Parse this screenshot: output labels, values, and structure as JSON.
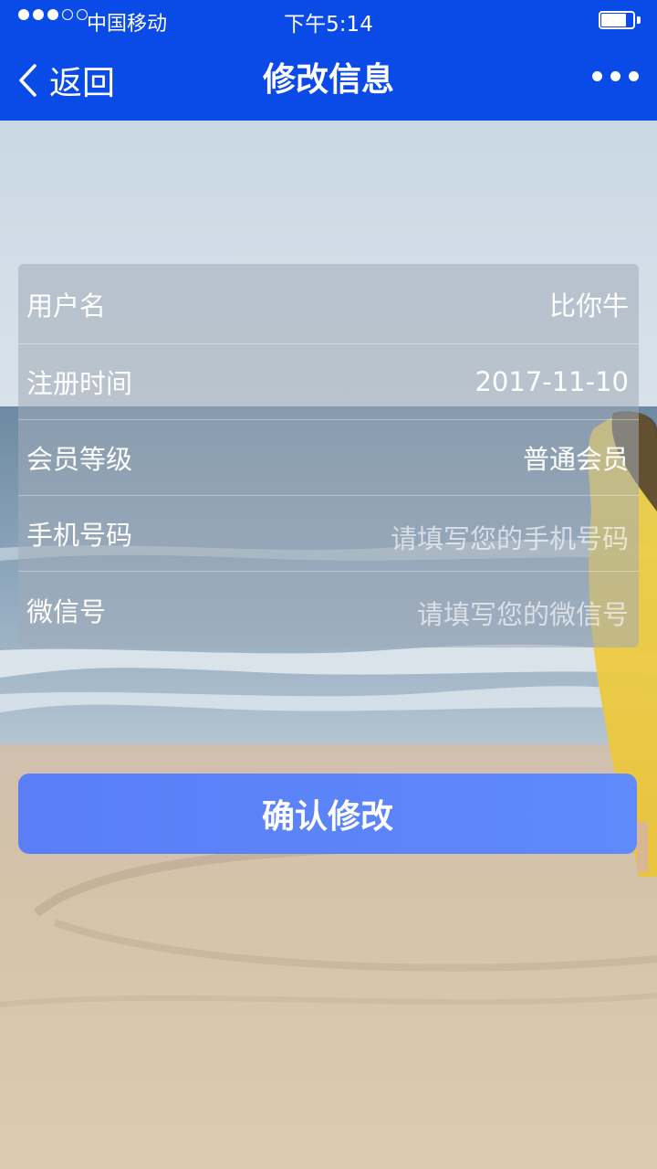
{
  "status_bar": {
    "signal_strength": 3,
    "signal_max": 5,
    "carrier": "中国移动",
    "time": "下午5:14",
    "battery_level": 0.8
  },
  "nav": {
    "back_label": "返回",
    "title": "修改信息"
  },
  "form": {
    "username": {
      "label": "用户名",
      "value": "比你牛"
    },
    "register_time": {
      "label": "注册时间",
      "value": "2017-11-10"
    },
    "member_level": {
      "label": "会员等级",
      "value": "普通会员"
    },
    "phone": {
      "label": "手机号码",
      "value": "",
      "placeholder": "请填写您的手机号码"
    },
    "wechat": {
      "label": "微信号",
      "value": "",
      "placeholder": "请填写您的微信号"
    }
  },
  "confirm_button": {
    "label": "确认修改"
  },
  "colors": {
    "nav_bar": "#0a4ae6",
    "button": "#5a80f8"
  }
}
